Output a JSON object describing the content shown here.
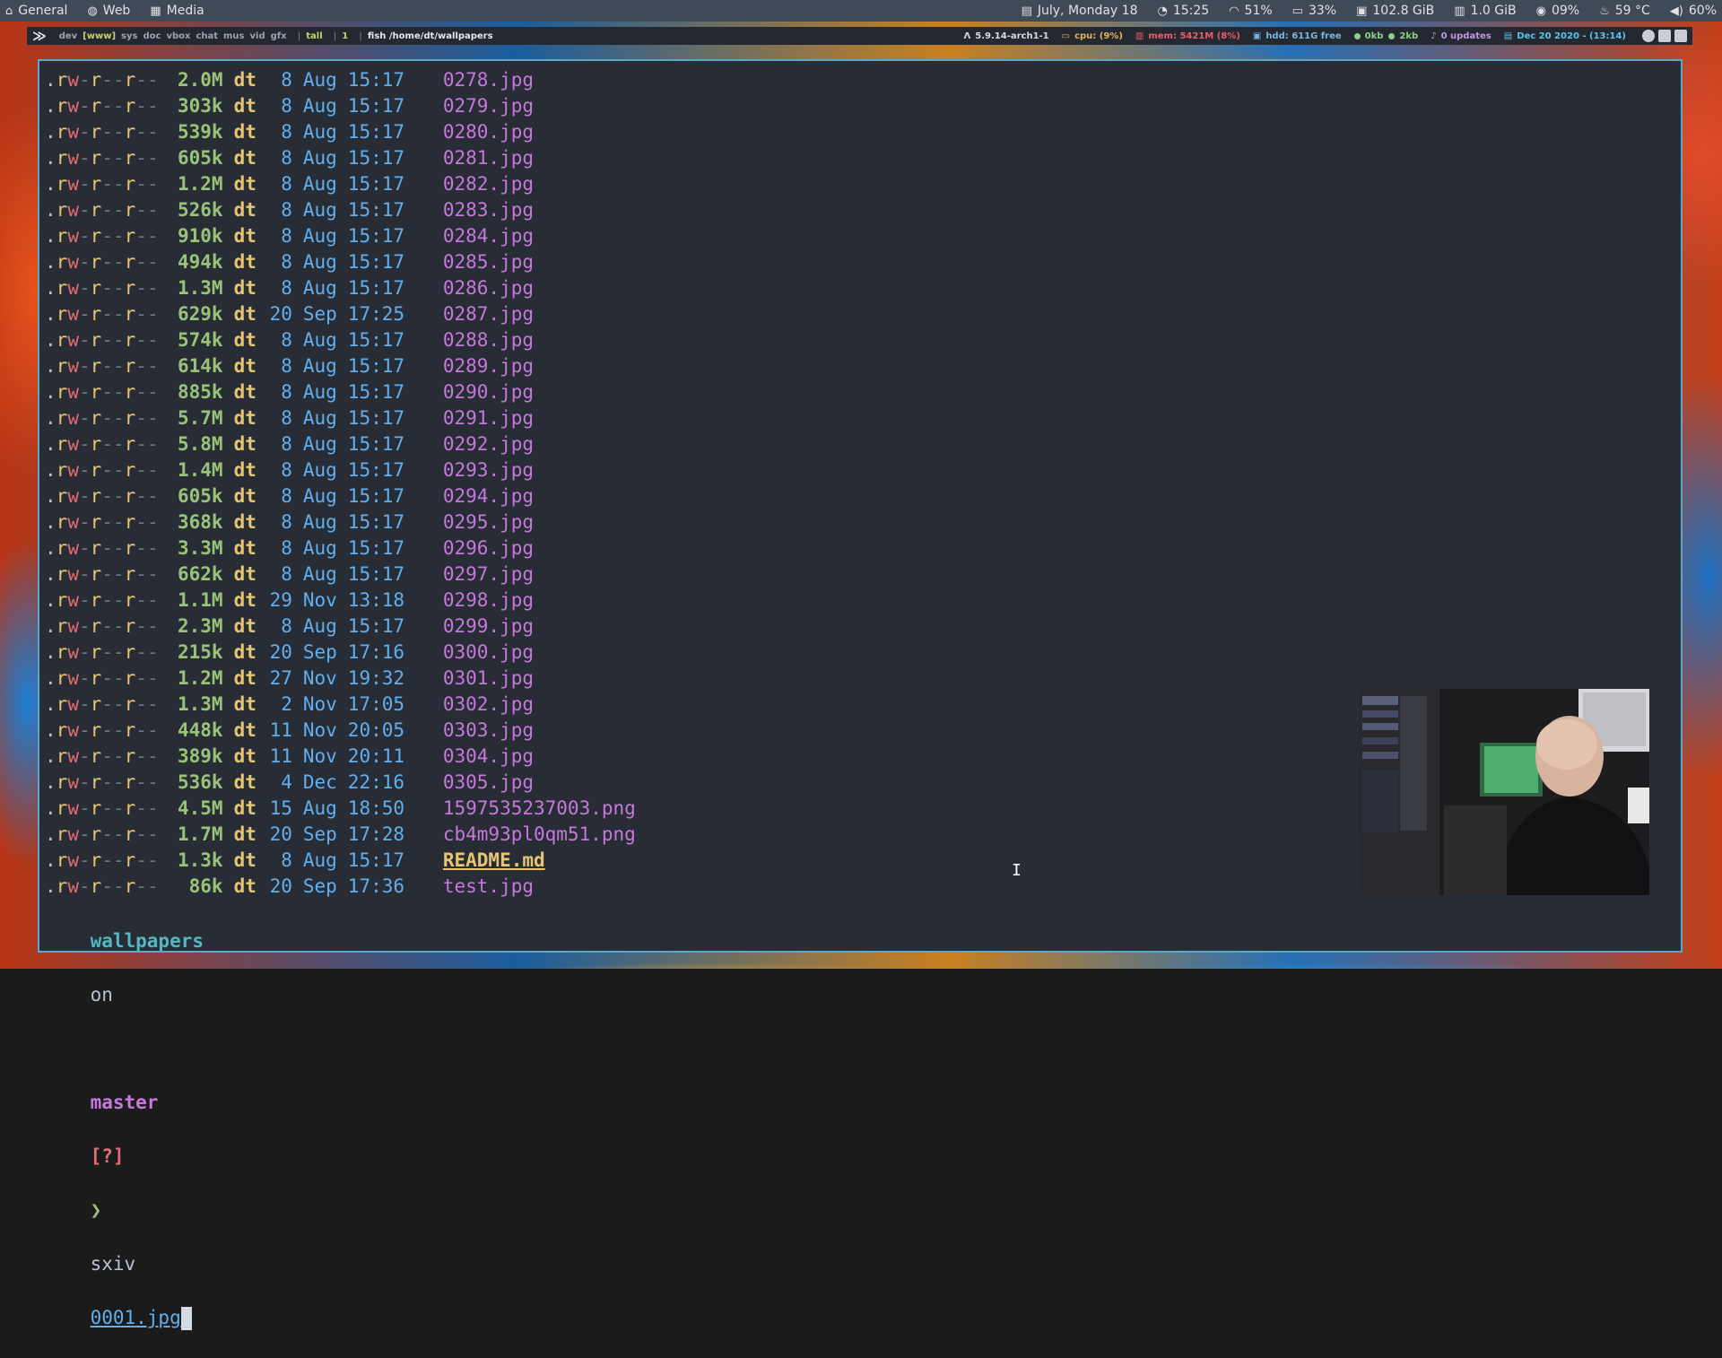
{
  "top_panel": {
    "left": [
      {
        "icon": "home-icon",
        "label": "General"
      },
      {
        "icon": "globe-icon",
        "label": "Web"
      },
      {
        "icon": "media-icon",
        "label": "Media"
      }
    ],
    "right": [
      {
        "icon": "calendar-icon",
        "label": "July, Monday 18"
      },
      {
        "icon": "clock-icon",
        "label": "15:25"
      },
      {
        "icon": "wifi-icon",
        "label": "51%"
      },
      {
        "icon": "battery-icon",
        "label": "33%"
      },
      {
        "icon": "disk-icon",
        "label": "102.8 GiB"
      },
      {
        "icon": "memory-icon",
        "label": "1.0 GiB"
      },
      {
        "icon": "cpu-icon",
        "label": "09%"
      },
      {
        "icon": "temperature-icon",
        "label": "59 °C"
      },
      {
        "icon": "volume-icon",
        "label": "60%"
      }
    ]
  },
  "xmobar": {
    "workspaces": [
      "dev",
      "[www]",
      "sys",
      "doc",
      "vbox",
      "chat",
      "mus",
      "vid",
      "gfx"
    ],
    "layout": "tall",
    "window_count": "1",
    "window_title": "fish /home/dt/wallpapers",
    "kernel": "5.9.14-arch1-1",
    "cpu": "cpu: (9%)",
    "mem": "mem: 5421M (8%)",
    "hdd": "hdd: 611G free",
    "net_down": "0kb",
    "net_up": "2kb",
    "updates": "0 updates",
    "date": "Dec 20 2020 - (13:14)"
  },
  "terminal": {
    "permissions": ".rw-r--r--",
    "files": [
      {
        "size": "2.0M",
        "user": "dt",
        "day": "8",
        "month": "Aug",
        "time": "15:17",
        "name": "0278.jpg"
      },
      {
        "size": "303k",
        "user": "dt",
        "day": "8",
        "month": "Aug",
        "time": "15:17",
        "name": "0279.jpg"
      },
      {
        "size": "539k",
        "user": "dt",
        "day": "8",
        "month": "Aug",
        "time": "15:17",
        "name": "0280.jpg"
      },
      {
        "size": "605k",
        "user": "dt",
        "day": "8",
        "month": "Aug",
        "time": "15:17",
        "name": "0281.jpg"
      },
      {
        "size": "1.2M",
        "user": "dt",
        "day": "8",
        "month": "Aug",
        "time": "15:17",
        "name": "0282.jpg"
      },
      {
        "size": "526k",
        "user": "dt",
        "day": "8",
        "month": "Aug",
        "time": "15:17",
        "name": "0283.jpg"
      },
      {
        "size": "910k",
        "user": "dt",
        "day": "8",
        "month": "Aug",
        "time": "15:17",
        "name": "0284.jpg"
      },
      {
        "size": "494k",
        "user": "dt",
        "day": "8",
        "month": "Aug",
        "time": "15:17",
        "name": "0285.jpg"
      },
      {
        "size": "1.3M",
        "user": "dt",
        "day": "8",
        "month": "Aug",
        "time": "15:17",
        "name": "0286.jpg"
      },
      {
        "size": "629k",
        "user": "dt",
        "day": "20",
        "month": "Sep",
        "time": "17:25",
        "name": "0287.jpg"
      },
      {
        "size": "574k",
        "user": "dt",
        "day": "8",
        "month": "Aug",
        "time": "15:17",
        "name": "0288.jpg"
      },
      {
        "size": "614k",
        "user": "dt",
        "day": "8",
        "month": "Aug",
        "time": "15:17",
        "name": "0289.jpg"
      },
      {
        "size": "885k",
        "user": "dt",
        "day": "8",
        "month": "Aug",
        "time": "15:17",
        "name": "0290.jpg"
      },
      {
        "size": "5.7M",
        "user": "dt",
        "day": "8",
        "month": "Aug",
        "time": "15:17",
        "name": "0291.jpg"
      },
      {
        "size": "5.8M",
        "user": "dt",
        "day": "8",
        "month": "Aug",
        "time": "15:17",
        "name": "0292.jpg"
      },
      {
        "size": "1.4M",
        "user": "dt",
        "day": "8",
        "month": "Aug",
        "time": "15:17",
        "name": "0293.jpg"
      },
      {
        "size": "605k",
        "user": "dt",
        "day": "8",
        "month": "Aug",
        "time": "15:17",
        "name": "0294.jpg"
      },
      {
        "size": "368k",
        "user": "dt",
        "day": "8",
        "month": "Aug",
        "time": "15:17",
        "name": "0295.jpg"
      },
      {
        "size": "3.3M",
        "user": "dt",
        "day": "8",
        "month": "Aug",
        "time": "15:17",
        "name": "0296.jpg"
      },
      {
        "size": "662k",
        "user": "dt",
        "day": "8",
        "month": "Aug",
        "time": "15:17",
        "name": "0297.jpg"
      },
      {
        "size": "1.1M",
        "user": "dt",
        "day": "29",
        "month": "Nov",
        "time": "13:18",
        "name": "0298.jpg"
      },
      {
        "size": "2.3M",
        "user": "dt",
        "day": "8",
        "month": "Aug",
        "time": "15:17",
        "name": "0299.jpg"
      },
      {
        "size": "215k",
        "user": "dt",
        "day": "20",
        "month": "Sep",
        "time": "17:16",
        "name": "0300.jpg"
      },
      {
        "size": "1.2M",
        "user": "dt",
        "day": "27",
        "month": "Nov",
        "time": "19:32",
        "name": "0301.jpg"
      },
      {
        "size": "1.3M",
        "user": "dt",
        "day": "2",
        "month": "Nov",
        "time": "17:05",
        "name": "0302.jpg"
      },
      {
        "size": "448k",
        "user": "dt",
        "day": "11",
        "month": "Nov",
        "time": "20:05",
        "name": "0303.jpg"
      },
      {
        "size": "389k",
        "user": "dt",
        "day": "11",
        "month": "Nov",
        "time": "20:11",
        "name": "0304.jpg"
      },
      {
        "size": "536k",
        "user": "dt",
        "day": "4",
        "month": "Dec",
        "time": "22:16",
        "name": "0305.jpg"
      },
      {
        "size": "4.5M",
        "user": "dt",
        "day": "15",
        "month": "Aug",
        "time": "18:50",
        "name": "1597535237003.png"
      },
      {
        "size": "1.7M",
        "user": "dt",
        "day": "20",
        "month": "Sep",
        "time": "17:28",
        "name": "cb4m93pl0qm51.png"
      },
      {
        "size": "1.3k",
        "user": "dt",
        "day": "8",
        "month": "Aug",
        "time": "15:17",
        "name": "README.md"
      },
      {
        "size": "86k",
        "user": "dt",
        "day": "20",
        "month": "Sep",
        "time": "17:36",
        "name": "test.jpg"
      }
    ],
    "prompt": {
      "dir": "wallpapers",
      "on": "on",
      "branch_icon": "",
      "branch": "master",
      "status": "[?]",
      "chevron": "❯",
      "command": "sxiv",
      "argument": "0001.jpg"
    }
  },
  "colors": {
    "panel_bg": "#3f4a56",
    "terminal_bg": "#282c34",
    "terminal_border": "#5aa7c8",
    "size": "#98c379",
    "user": "#e7c572",
    "date": "#61afef",
    "filename": "#c678dd"
  }
}
